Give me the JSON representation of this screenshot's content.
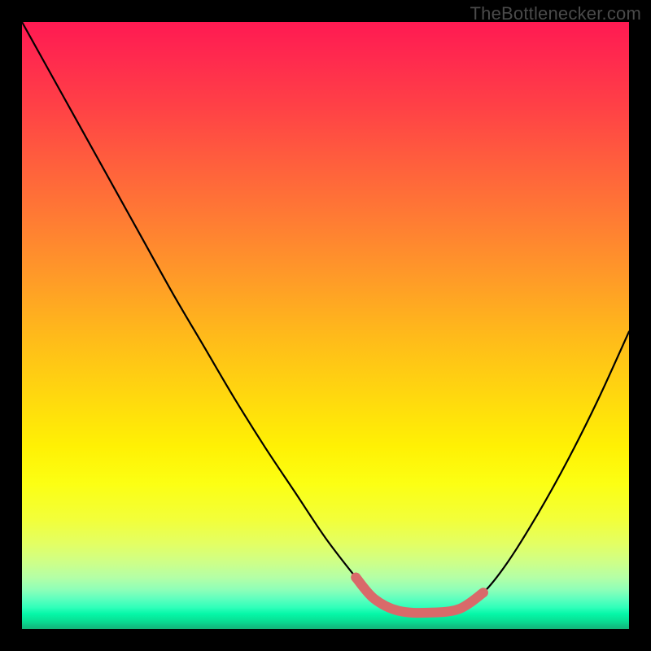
{
  "watermark": "TheBottlenecker.com",
  "chart_data": {
    "type": "line",
    "title": "",
    "xlabel": "",
    "ylabel": "",
    "xlim": [
      0,
      100
    ],
    "ylim": [
      0,
      100
    ],
    "series": [
      {
        "name": "bottleneck-curve",
        "x": [
          0,
          5,
          10,
          15,
          20,
          25,
          30,
          35,
          40,
          45,
          50,
          55,
          58,
          62,
          67,
          72,
          76,
          80,
          85,
          90,
          95,
          100
        ],
        "y": [
          100,
          91,
          82,
          73,
          64,
          55,
          46.5,
          38,
          30,
          22.5,
          15,
          8.5,
          5,
          3,
          2.7,
          3.3,
          6,
          11,
          19,
          28,
          38,
          49
        ]
      }
    ],
    "annotations": [
      {
        "name": "optimal-range-marker",
        "type": "highlight",
        "x": [
          55,
          58,
          62,
          67,
          72,
          76
        ],
        "y": [
          8.5,
          5,
          3,
          2.7,
          3.3,
          6
        ],
        "color": "#d96a6a"
      }
    ],
    "background_gradient": {
      "direction": "vertical",
      "stops": [
        {
          "pos": 0,
          "color": "#ff1a52"
        },
        {
          "pos": 50,
          "color": "#ffcc10"
        },
        {
          "pos": 80,
          "color": "#f5ff30"
        },
        {
          "pos": 100,
          "color": "#12b578"
        }
      ]
    }
  }
}
